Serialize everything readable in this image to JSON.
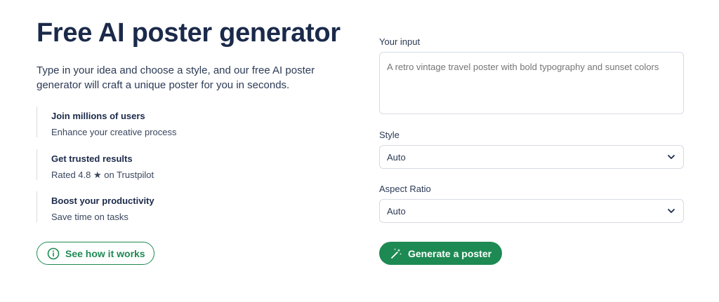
{
  "hero": {
    "title": "Free AI poster generator",
    "subtitle": "Type in your idea and choose a style, and our free AI poster generator will craft a unique poster for you in seconds."
  },
  "features": [
    {
      "title": "Join millions of users",
      "desc": "Enhance your creative process"
    },
    {
      "title": "Get trusted results",
      "desc": "Rated 4.8 ★ on Trustpilot"
    },
    {
      "title": "Boost your productivity",
      "desc": "Save time on tasks"
    }
  ],
  "how_button": {
    "label": "See how it works",
    "icon": "info-circle-icon"
  },
  "form": {
    "input_label": "Your input",
    "input_placeholder": "A retro vintage travel poster with bold typography and sunset colors",
    "style_label": "Style",
    "style_value": "Auto",
    "aspect_label": "Aspect Ratio",
    "aspect_value": "Auto",
    "generate_label": "Generate a poster",
    "generate_icon": "magic-wand-icon"
  },
  "colors": {
    "brand_green": "#1e8a53",
    "heading": "#1b2a4a",
    "border": "#d6dbe3"
  }
}
